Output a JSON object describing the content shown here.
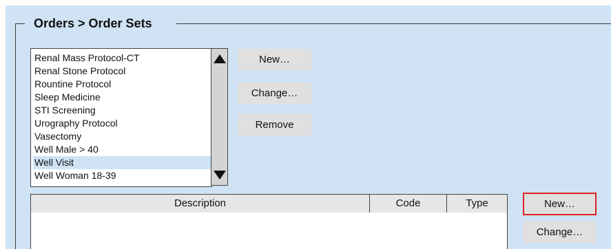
{
  "group": {
    "title": "Orders > Order Sets"
  },
  "order_sets_list": {
    "items": [
      "Renal Mass Protocol-CT",
      "Renal Stone Protocol",
      "Rountine Protocol",
      "Sleep Medicine",
      "STI Screening",
      "Urography Protocol",
      "Vasectomy",
      "Well Male > 40",
      "Well Visit",
      "Well Woman 18-39"
    ],
    "selected": "Well Visit"
  },
  "set_buttons": {
    "new_label": "New…",
    "change_label": "Change…",
    "remove_label": "Remove"
  },
  "orders_table": {
    "columns": [
      "Description",
      "Code",
      "Type"
    ]
  },
  "order_buttons": {
    "new_label": "New…",
    "change_label": "Change…"
  },
  "colors": {
    "panel_background": "#cfe3f4",
    "highlight_border": "#e02020"
  }
}
